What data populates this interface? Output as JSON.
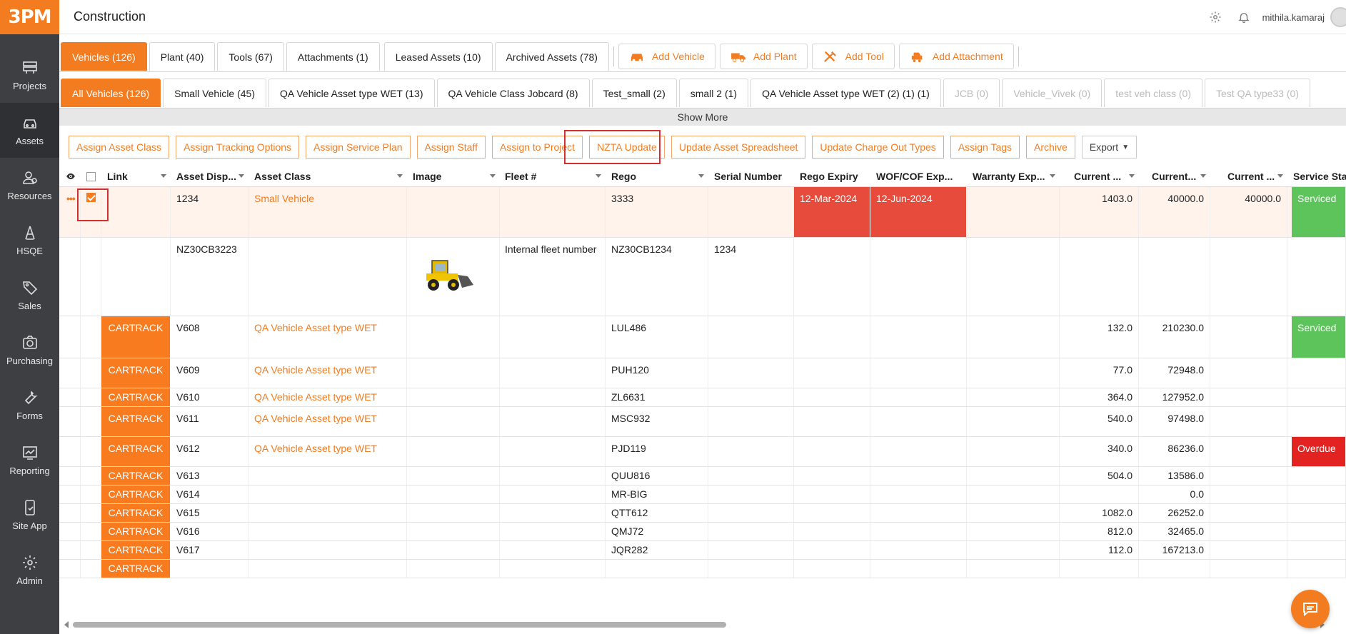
{
  "brand": {
    "logo": "3PM",
    "accent": "#f47c20"
  },
  "header": {
    "title": "Construction",
    "username": "mithila.kamaraj"
  },
  "sidebar": {
    "items": [
      {
        "label": "Projects",
        "icon": "projects-icon"
      },
      {
        "label": "Assets",
        "icon": "car-icon",
        "active": true
      },
      {
        "label": "Resources",
        "icon": "resources-icon"
      },
      {
        "label": "HSQE",
        "icon": "hsqe-icon"
      },
      {
        "label": "Sales",
        "icon": "tag-icon"
      },
      {
        "label": "Purchasing",
        "icon": "purchasing-icon"
      },
      {
        "label": "Forms",
        "icon": "wrench-icon"
      },
      {
        "label": "Reporting",
        "icon": "chart-icon"
      },
      {
        "label": "Site App",
        "icon": "mobile-icon"
      },
      {
        "label": "Admin",
        "icon": "gear-icon"
      }
    ]
  },
  "tabs1": [
    "Vehicles (126)",
    "Plant (40)",
    "Tools (67)",
    "Attachments (1)",
    "Leased Assets (10)",
    "Archived Assets (78)"
  ],
  "add_buttons": [
    "Add Vehicle",
    "Add Plant",
    "Add Tool",
    "Add Attachment"
  ],
  "tabs2": [
    "All Vehicles (126)",
    "Small Vehicle (45)",
    "QA Vehicle Asset type WET (13)",
    "QA Vehicle Class Jobcard (8)",
    "Test_small (2)",
    "small 2 (1)",
    "QA Vehicle Asset type WET (2) (1) (1)",
    "JCB (0)",
    "Vehicle_Vivek (0)",
    "test veh class (0)",
    "Test QA type33 (0)"
  ],
  "show_more": "Show More",
  "actions": [
    "Assign Asset Class",
    "Assign Tracking Options",
    "Assign Service Plan",
    "Assign Staff",
    "Assign to Project",
    "NZTA Update",
    "Update Asset Spreadsheet",
    "Update Charge Out Types",
    "Assign Tags",
    "Archive",
    "Export"
  ],
  "columns": [
    "Link",
    "Asset Disp...",
    "Asset Class",
    "Image",
    "Fleet #",
    "Rego",
    "Serial Number",
    "Rego Expiry",
    "WOF/COF Exp...",
    "Warranty Exp...",
    "Current ...",
    "Current...",
    "Current ...",
    "Service Sta"
  ],
  "rows": [
    {
      "link": "",
      "disp": "1234",
      "cls": "Small Vehicle",
      "fleet": "",
      "rego": "3333",
      "serial": "",
      "rego_exp": "12-Mar-2024",
      "wof": "12-Jun-2024",
      "c1": "1403.0",
      "c2": "40000.0",
      "c3": "40000.0",
      "status": "Serviced"
    },
    {
      "link": "",
      "disp": "NZ30CB3223",
      "cls": "",
      "fleet": "Internal fleet number",
      "rego": "NZ30CB1234",
      "serial": "1234",
      "rego_exp": "",
      "wof": "",
      "c1": "",
      "c2": "",
      "c3": "",
      "status": ""
    },
    {
      "link": "CARTRACK",
      "disp": "V608",
      "cls": "QA Vehicle Asset type WET",
      "fleet": "",
      "rego": "LUL486",
      "serial": "",
      "rego_exp": "",
      "wof": "",
      "c1": "132.0",
      "c2": "210230.0",
      "c3": "",
      "status": "Serviced"
    },
    {
      "link": "CARTRACK",
      "disp": "V609",
      "cls": "QA Vehicle Asset type WET",
      "fleet": "",
      "rego": "PUH120",
      "serial": "",
      "rego_exp": "",
      "wof": "",
      "c1": "77.0",
      "c2": "72948.0",
      "c3": "",
      "status": ""
    },
    {
      "link": "CARTRACK",
      "disp": "V610",
      "cls": "QA Vehicle Asset type WET",
      "fleet": "",
      "rego": "ZL6631",
      "serial": "",
      "rego_exp": "",
      "wof": "",
      "c1": "364.0",
      "c2": "127952.0",
      "c3": "",
      "status": ""
    },
    {
      "link": "CARTRACK",
      "disp": "V611",
      "cls": "QA Vehicle Asset type WET",
      "fleet": "",
      "rego": "MSC932",
      "serial": "",
      "rego_exp": "",
      "wof": "",
      "c1": "540.0",
      "c2": "97498.0",
      "c3": "",
      "status": ""
    },
    {
      "link": "CARTRACK",
      "disp": "V612",
      "cls": "QA Vehicle Asset type WET",
      "fleet": "",
      "rego": "PJD119",
      "serial": "",
      "rego_exp": "",
      "wof": "",
      "c1": "340.0",
      "c2": "86236.0",
      "c3": "",
      "status": "Overdue"
    },
    {
      "link": "CARTRACK",
      "disp": "V613",
      "cls": "",
      "fleet": "",
      "rego": "QUU816",
      "serial": "",
      "rego_exp": "",
      "wof": "",
      "c1": "504.0",
      "c2": "13586.0",
      "c3": "",
      "status": ""
    },
    {
      "link": "CARTRACK",
      "disp": "V614",
      "cls": "",
      "fleet": "",
      "rego": "MR-BIG",
      "serial": "",
      "rego_exp": "",
      "wof": "",
      "c1": "",
      "c2": "0.0",
      "c3": "",
      "status": ""
    },
    {
      "link": "CARTRACK",
      "disp": "V615",
      "cls": "",
      "fleet": "",
      "rego": "QTT612",
      "serial": "",
      "rego_exp": "",
      "wof": "",
      "c1": "1082.0",
      "c2": "26252.0",
      "c3": "",
      "status": ""
    },
    {
      "link": "CARTRACK",
      "disp": "V616",
      "cls": "",
      "fleet": "",
      "rego": "QMJ72",
      "serial": "",
      "rego_exp": "",
      "wof": "",
      "c1": "812.0",
      "c2": "32465.0",
      "c3": "",
      "status": ""
    },
    {
      "link": "CARTRACK",
      "disp": "V617",
      "cls": "",
      "fleet": "",
      "rego": "JQR282",
      "serial": "",
      "rego_exp": "",
      "wof": "",
      "c1": "112.0",
      "c2": "167213.0",
      "c3": "",
      "status": ""
    },
    {
      "link": "CARTRACK",
      "disp": "",
      "cls": "",
      "fleet": "",
      "rego": "",
      "serial": "",
      "rego_exp": "",
      "wof": "",
      "c1": "",
      "c2": "",
      "c3": "",
      "status": ""
    }
  ]
}
